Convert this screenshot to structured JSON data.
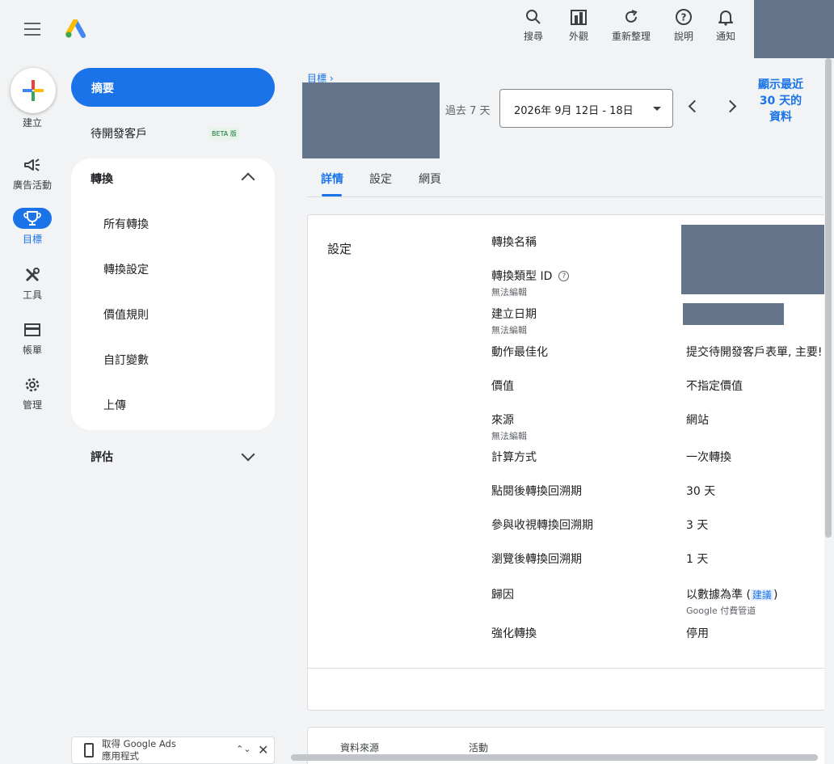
{
  "topbar": {
    "tools": [
      {
        "label": "搜尋",
        "icon": "search-icon"
      },
      {
        "label": "外觀",
        "icon": "appearance-icon"
      },
      {
        "label": "重新整理",
        "icon": "refresh-icon"
      },
      {
        "label": "說明",
        "icon": "help-icon"
      },
      {
        "label": "通知",
        "icon": "bell-icon"
      }
    ]
  },
  "rail": {
    "create": "建立",
    "items": [
      {
        "label": "廣告活動",
        "icon": "megaphone-icon"
      },
      {
        "label": "目標",
        "icon": "trophy-icon"
      },
      {
        "label": "工具",
        "icon": "tools-icon"
      },
      {
        "label": "帳單",
        "icon": "credit-card-icon"
      },
      {
        "label": "管理",
        "icon": "gear-icon"
      }
    ]
  },
  "nav": {
    "summary": "摘要",
    "leads": "待開發客戶",
    "beta": "BETA 版",
    "conversions": "轉換",
    "sub": [
      "所有轉換",
      "轉換設定",
      "價值規則",
      "自訂變數",
      "上傳"
    ],
    "evaluation": "評估"
  },
  "promo": {
    "line1": "取得 Google Ads",
    "line2": "應用程式"
  },
  "header": {
    "breadcrumb": "目標 ›",
    "range_label": "過去 7 天",
    "date_range": "2026年 9月 12日 - 18日",
    "show30": "顯示最近 30 天的資料"
  },
  "tabs": [
    "詳情",
    "設定",
    "網頁"
  ],
  "settings": {
    "title": "設定",
    "rows": [
      {
        "label": "轉換名稱"
      },
      {
        "label": "轉換類型 ID",
        "hint": "無法編輯"
      },
      {
        "label": "建立日期",
        "hint": "無法編輯"
      },
      {
        "label": "動作最佳化",
        "value": "提交待開發客戶表單, 主要!"
      },
      {
        "label": "價值",
        "value": "不指定價值"
      },
      {
        "label": "來源",
        "hint": "無法編輯",
        "value": "網站"
      },
      {
        "label": "計算方式",
        "value": "一次轉換"
      },
      {
        "label": "點閱後轉換回溯期",
        "value": "30 天"
      },
      {
        "label": "參與收視轉換回溯期",
        "value": "3 天"
      },
      {
        "label": "瀏覽後轉換回溯期",
        "value": "1 天"
      },
      {
        "label": "歸因",
        "value": "以數據為準 (",
        "link": "建議",
        "value_end": ")",
        "value_sub": "Google 付費管道"
      },
      {
        "label": "強化轉換",
        "value": "停用"
      }
    ]
  },
  "table2": {
    "col1": "資料來源",
    "col2": "活動"
  }
}
